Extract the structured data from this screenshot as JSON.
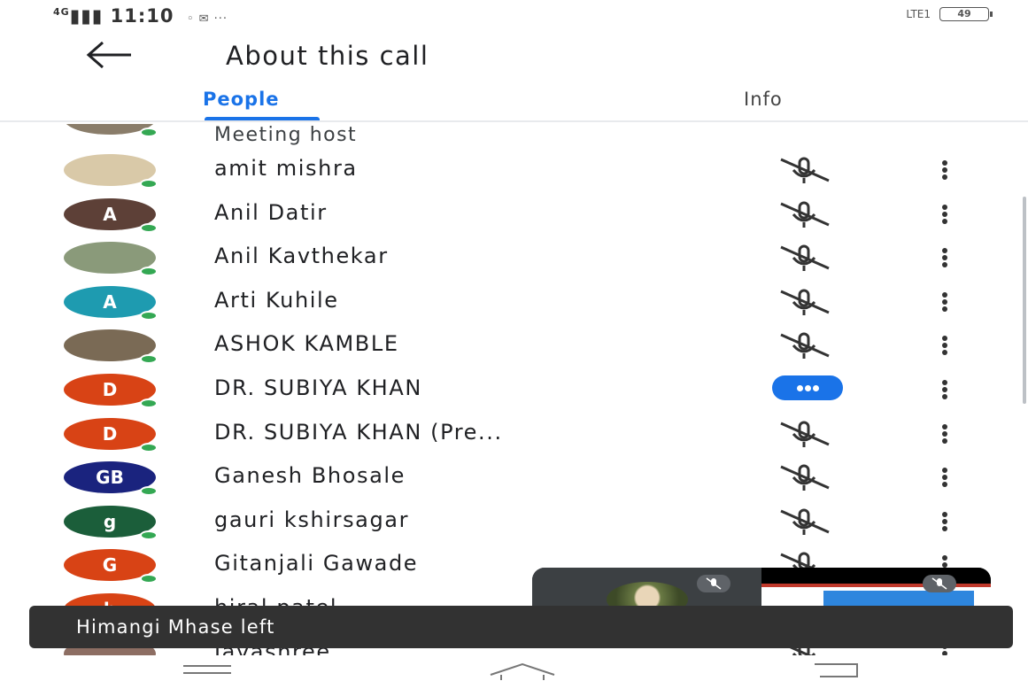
{
  "status_bar": {
    "network": "4G",
    "time": "11:10",
    "battery": "49"
  },
  "app_bar": {
    "title": "About this call",
    "back_icon": "arrow-left-icon"
  },
  "tabs": [
    {
      "label": "People",
      "active": true
    },
    {
      "label": "Info",
      "active": false
    }
  ],
  "colors": {
    "accent": "#1a73e8",
    "online": "#34a853",
    "snackbar": "#323232"
  },
  "host_label": "Meeting host",
  "participants": [
    {
      "name": "amit mishra",
      "initial": "",
      "avatar_color": "#d9c9a8",
      "status": "muted"
    },
    {
      "name": "Anil Datir",
      "initial": "A",
      "avatar_color": "#5d4037",
      "status": "muted"
    },
    {
      "name": "Anil Kavthekar",
      "initial": "",
      "avatar_color": "#8a9a7a",
      "status": "muted"
    },
    {
      "name": "Arti Kuhile",
      "initial": "A",
      "avatar_color": "#1e9bb0",
      "status": "muted"
    },
    {
      "name": "ASHOK KAMBLE",
      "initial": "",
      "avatar_color": "#7a6a55",
      "status": "muted"
    },
    {
      "name": "DR. SUBIYA KHAN",
      "initial": "D",
      "avatar_color": "#d84315",
      "status": "speaking"
    },
    {
      "name": "DR. SUBIYA KHAN (Pre...",
      "initial": "D",
      "avatar_color": "#d84315",
      "status": "muted"
    },
    {
      "name": "Ganesh Bhosale",
      "initial": "GB",
      "avatar_color": "#1a237e",
      "status": "muted"
    },
    {
      "name": "gauri kshirsagar",
      "initial": "g",
      "avatar_color": "#1b5e3a",
      "status": "muted"
    },
    {
      "name": "Gitanjali Gawade",
      "initial": "G",
      "avatar_color": "#d84315",
      "status": "muted"
    },
    {
      "name": "hiral patel",
      "initial": "h",
      "avatar_color": "#d84315",
      "status": "muted"
    },
    {
      "name": "Jayashree",
      "initial": "",
      "avatar_color": "#8d6e63",
      "status": "muted"
    }
  ],
  "snackbar": {
    "message": "Himangi Mhase left"
  }
}
